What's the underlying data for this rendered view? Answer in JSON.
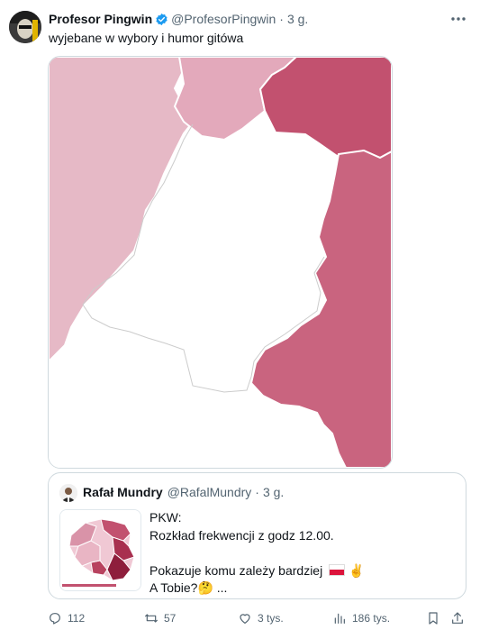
{
  "tweet": {
    "author_name": "Profesor Pingwin",
    "handle": "@ProfesorPingwin",
    "separator": "·",
    "time": "3 g.",
    "text": "wyjebane w wybory i humor gitówa",
    "avatar_icon": "avatar-face-icon",
    "verified_icon": "verified-badge-icon",
    "more_icon": "more-options-icon"
  },
  "media": {
    "description_icon": "map-crop-image",
    "colors": {
      "light_pink": "#e6b9c6",
      "mid_pink": "#e3a9bb",
      "deep_rose": "#c2516f",
      "rose": "#c9647f",
      "blank": "#ffffff"
    }
  },
  "quote": {
    "author_name": "Rafał Mundry",
    "handle": "@RafalMundry",
    "separator": "·",
    "time": "3 g.",
    "lines": [
      "PKW:",
      "Rozkład frekwencji z godz 12.00.",
      "",
      "Pokazuje komu zależy bardziej",
      "A Tobie?🤔 ..."
    ],
    "emoji_line4": "✌️"
  },
  "actions": {
    "reply_count": "112",
    "retweet_count": "57",
    "like_count": "3 tys.",
    "views_count": "186 tys.",
    "icons": [
      "reply-icon",
      "retweet-icon",
      "like-icon",
      "views-icon",
      "bookmark-icon",
      "share-icon"
    ]
  }
}
